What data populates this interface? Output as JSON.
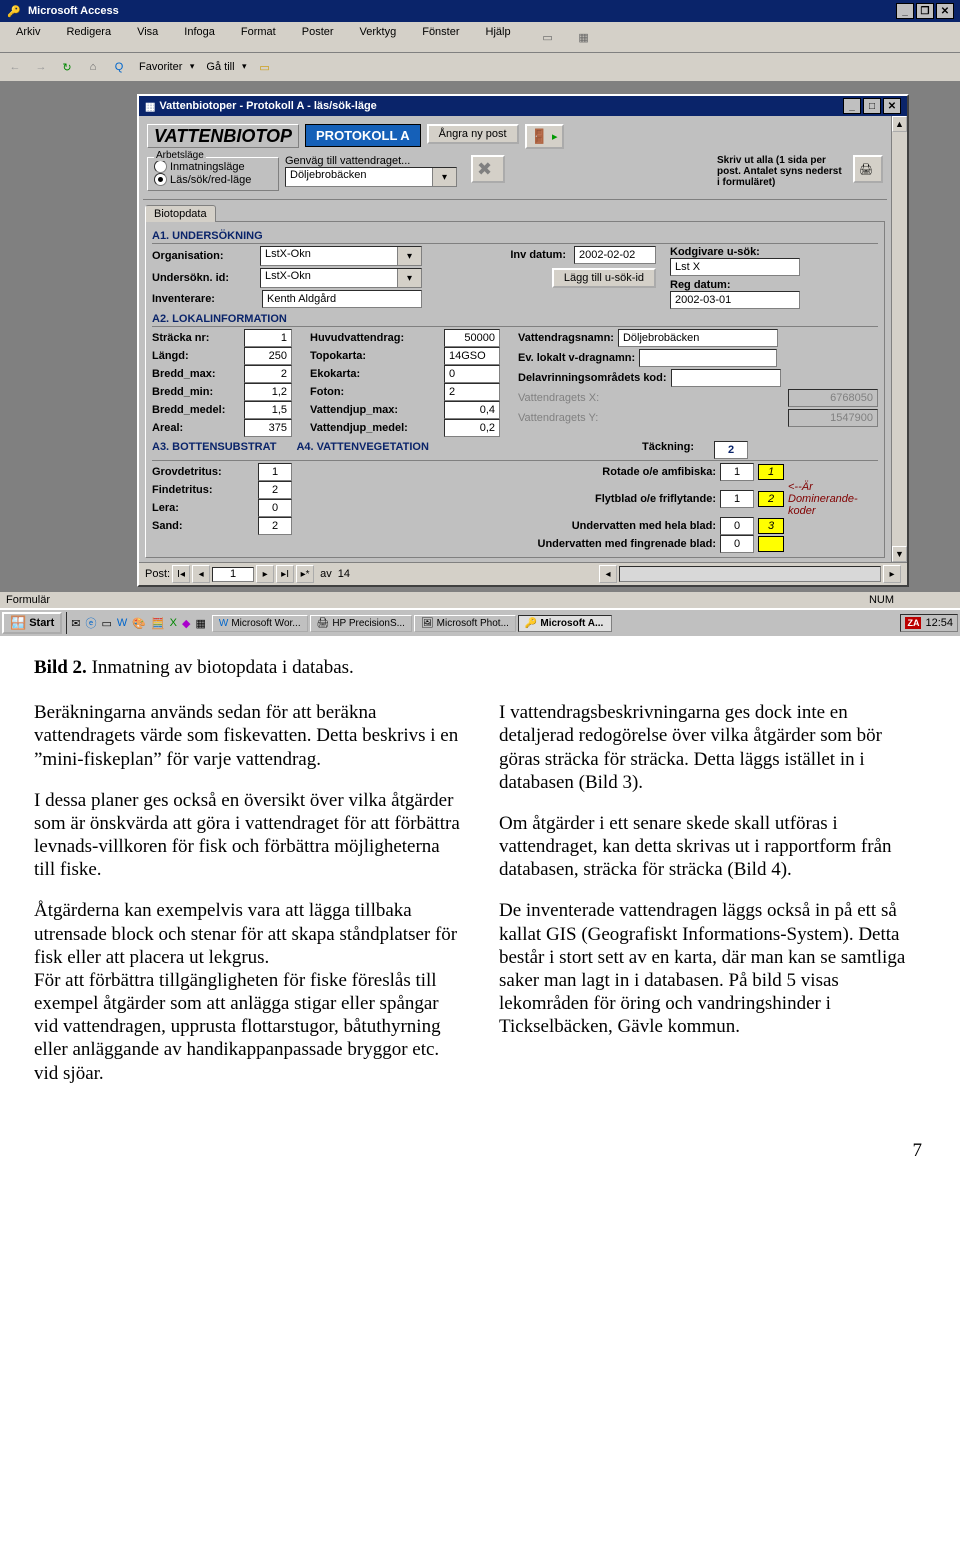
{
  "app": {
    "title": "Microsoft Access"
  },
  "menu": {
    "arkiv": "Arkiv",
    "redigera": "Redigera",
    "visa": "Visa",
    "infoga": "Infoga",
    "format": "Format",
    "poster": "Poster",
    "verktyg": "Verktyg",
    "fonster": "Fönster",
    "hjalp": "Hjälp"
  },
  "toolbar2": {
    "favoriter": "Favoriter",
    "gatill": "Gå till"
  },
  "form_window": {
    "title": "Vattenbiotoper - Protokoll A - läs/sök-läge",
    "logo": "VATTENBIOTOP",
    "protokoll": "PROTOKOLL A",
    "angra": "Ångra ny post",
    "arbetslage_legend": "Arbetsläge",
    "radio1": "Inmatningsläge",
    "radio2": "Läs/sök/red-läge",
    "genvag_label": "Genväg till vattendraget...",
    "genvag_value": "Döljebrobäcken",
    "skriv_ut": "Skriv ut alla (1 sida per post. Antalet syns nederst i formuläret)",
    "tab": "Biotopdata",
    "a1": {
      "title": "A1. UNDERSÖKNING",
      "organisation_l": "Organisation:",
      "organisation_v": "LstX-Okn",
      "undersokn_l": "Undersökn. id:",
      "undersokn_v": "LstX-Okn",
      "inventer_l": "Inventerare:",
      "inventer_v": "Kenth Aldgård",
      "invdatum_l": "Inv datum:",
      "invdatum_v": "2002-02-02",
      "laggtill": "Lägg till u-sök-id",
      "kodgivare_l": "Kodgivare u-sök:",
      "kodgivare_v": "Lst X",
      "regdatum_l": "Reg datum:",
      "regdatum_v": "2002-03-01"
    },
    "a2": {
      "title": "A2. LOKALINFORMATION",
      "stracka_l": "Sträcka nr:",
      "stracka_v": "1",
      "langd_l": "Längd:",
      "langd_v": "250",
      "bredd_max_l": "Bredd_max:",
      "bredd_max_v": "2",
      "bredd_min_l": "Bredd_min:",
      "bredd_min_v": "1,2",
      "bredd_medel_l": "Bredd_medel:",
      "bredd_medel_v": "1,5",
      "areal_l": "Areal:",
      "areal_v": "375",
      "huvudvatten_l": "Huvudvattendrag:",
      "huvudvatten_v": "50000",
      "topokarta_l": "Topokarta:",
      "topokarta_v": "14GSO",
      "ekokarta_l": "Ekokarta:",
      "ekokarta_v": "0",
      "foton_l": "Foton:",
      "foton_v": "2",
      "vdjupmax_l": "Vattendjup_max:",
      "vdjupmax_v": "0,4",
      "vdjupmed_l": "Vattendjup_medel:",
      "vdjupmed_v": "0,2",
      "vnamn_l": "Vattendragsnamn:",
      "vnamn_v": "Döljebrobäcken",
      "evlokalt_l": "Ev. lokalt v-dragnamn:",
      "evlokalt_v": "",
      "delavrin_l": "Delavrinningsområdets kod:",
      "delavrin_v": "",
      "vx_l": "Vattendragets X:",
      "vx_v": "6768050",
      "vy_l": "Vattendragets Y:",
      "vy_v": "1547900"
    },
    "a3": {
      "title": "A3. BOTTENSUBSTRAT",
      "grov_l": "Grovdetritus:",
      "grov_v": "1",
      "find_l": "Findetritus:",
      "find_v": "2",
      "lera_l": "Lera:",
      "lera_v": "0",
      "sand_l": "Sand:",
      "sand_v": "2"
    },
    "a4": {
      "title": "A4. VATTENVEGETATION",
      "tack_l": "Täckning:",
      "tack_v": "2",
      "rot_l": "Rotade o/e amfibiska:",
      "rot_v": "1",
      "rot_k": "1",
      "flyt_l": "Flytblad o/e friflytande:",
      "flyt_v": "1",
      "flyt_k": "2",
      "uvhel_l": "Undervatten med hela blad:",
      "uvhel_v": "0",
      "uvhel_k": "3",
      "uvfin_l": "Undervatten med fingrenade blad:",
      "uvfin_v": "0",
      "yellow_note": "<--Är Dominerande-koder"
    },
    "recnav": {
      "prefix": "Post:",
      "cur": "1",
      "of": "av",
      "total": "14"
    }
  },
  "statusbar": {
    "left": "Formulär",
    "num": "NUM"
  },
  "taskbar": {
    "start": "Start",
    "t1": "Microsoft Wor...",
    "t2": "HP PrecisionS...",
    "t3": "Microsoft Phot...",
    "t4": "Microsoft A...",
    "time": "12:54"
  },
  "doc": {
    "caption_b": "Bild 2.",
    "caption_rest": " Inmatning av biotopdata i databas.",
    "left": {
      "p1": "Beräkningarna används sedan för att beräkna vattendragets värde som fiskevatten. Detta beskrivs i en ”mini-fiskeplan” för varje vattendrag.",
      "p2": "I dessa planer ges också en översikt över vilka åtgärder som är önskvärda att göra i vattendraget för att förbättra levnads-villkoren för fisk och förbättra möjligheterna till fiske.",
      "p3": "Åtgärderna kan exempelvis vara att lägga tillbaka utrensade block och stenar för att skapa ståndplatser för fisk eller att placera ut lekgrus.",
      "p4": "För att förbättra tillgängligheten för fiske föreslås till exempel åtgärder som att anlägga stigar eller spångar vid vattendragen, upprusta flottarstugor, båtuthyrning eller anläggande av handikappanpassade bryggor etc. vid sjöar."
    },
    "right": {
      "p1": "I vattendragsbeskrivningarna ges dock inte en detaljerad redogörelse över vilka åtgärder som bör göras sträcka för sträcka. Detta läggs istället in i databasen (Bild 3).",
      "p2": "Om åtgärder i ett senare skede skall utföras i vattendraget, kan detta skrivas ut i rapportform från databasen, sträcka för sträcka (Bild 4).",
      "p3": "De inventerade vattendragen läggs också in på ett så kallat GIS (Geografiskt Informations-System). Detta består i stort sett av en karta, där man kan se samtliga saker man lagt in i databasen. På bild 5 visas lekområden för öring och vandringshinder i Tickselbäcken, Gävle kommun."
    },
    "page": "7"
  }
}
